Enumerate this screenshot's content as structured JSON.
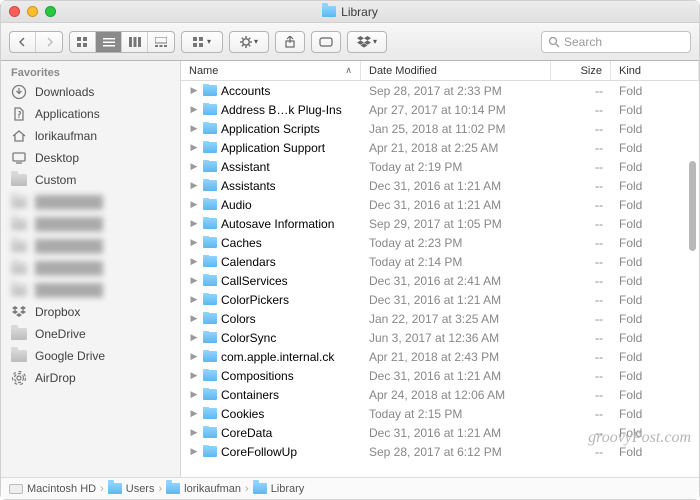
{
  "window": {
    "title": "Library"
  },
  "toolbar": {
    "search_placeholder": "Search"
  },
  "sidebar": {
    "header": "Favorites",
    "items": [
      {
        "label": "Downloads",
        "icon": "downloads"
      },
      {
        "label": "Applications",
        "icon": "applications"
      },
      {
        "label": "lorikaufman",
        "icon": "home"
      },
      {
        "label": "Desktop",
        "icon": "desktop"
      },
      {
        "label": "Custom",
        "icon": "folder"
      }
    ],
    "blurred_count": 5,
    "items2": [
      {
        "label": "Dropbox",
        "icon": "dropbox"
      },
      {
        "label": "OneDrive",
        "icon": "folder"
      },
      {
        "label": "Google Drive",
        "icon": "folder"
      },
      {
        "label": "AirDrop",
        "icon": "airdrop"
      }
    ]
  },
  "columns": {
    "name": "Name",
    "date": "Date Modified",
    "size": "Size",
    "kind": "Kind"
  },
  "sort": {
    "column": "name",
    "direction": "asc"
  },
  "rows": [
    {
      "name": "Accounts",
      "date": "Sep 28, 2017 at 2:33 PM",
      "size": "--",
      "kind": "Folder"
    },
    {
      "name": "Address B…k Plug-Ins",
      "date": "Apr 27, 2017 at 10:14 PM",
      "size": "--",
      "kind": "Folder"
    },
    {
      "name": "Application Scripts",
      "date": "Jan 25, 2018 at 11:02 PM",
      "size": "--",
      "kind": "Folder"
    },
    {
      "name": "Application Support",
      "date": "Apr 21, 2018 at 2:25 AM",
      "size": "--",
      "kind": "Folder"
    },
    {
      "name": "Assistant",
      "date": "Today at 2:19 PM",
      "size": "--",
      "kind": "Folder"
    },
    {
      "name": "Assistants",
      "date": "Dec 31, 2016 at 1:21 AM",
      "size": "--",
      "kind": "Folder"
    },
    {
      "name": "Audio",
      "date": "Dec 31, 2016 at 1:21 AM",
      "size": "--",
      "kind": "Folder"
    },
    {
      "name": "Autosave Information",
      "date": "Sep 29, 2017 at 1:05 PM",
      "size": "--",
      "kind": "Folder"
    },
    {
      "name": "Caches",
      "date": "Today at 2:23 PM",
      "size": "--",
      "kind": "Folder"
    },
    {
      "name": "Calendars",
      "date": "Today at 2:14 PM",
      "size": "--",
      "kind": "Folder"
    },
    {
      "name": "CallServices",
      "date": "Dec 31, 2016 at 2:41 AM",
      "size": "--",
      "kind": "Folder"
    },
    {
      "name": "ColorPickers",
      "date": "Dec 31, 2016 at 1:21 AM",
      "size": "--",
      "kind": "Folder"
    },
    {
      "name": "Colors",
      "date": "Jan 22, 2017 at 3:25 AM",
      "size": "--",
      "kind": "Folder"
    },
    {
      "name": "ColorSync",
      "date": "Jun 3, 2017 at 12:36 AM",
      "size": "--",
      "kind": "Folder"
    },
    {
      "name": "com.apple.internal.ck",
      "date": "Apr 21, 2018 at 2:43 PM",
      "size": "--",
      "kind": "Folder"
    },
    {
      "name": "Compositions",
      "date": "Dec 31, 2016 at 1:21 AM",
      "size": "--",
      "kind": "Folder"
    },
    {
      "name": "Containers",
      "date": "Apr 24, 2018 at 12:06 AM",
      "size": "--",
      "kind": "Folder"
    },
    {
      "name": "Cookies",
      "date": "Today at 2:15 PM",
      "size": "--",
      "kind": "Folder"
    },
    {
      "name": "CoreData",
      "date": "Dec 31, 2016 at 1:21 AM",
      "size": "--",
      "kind": "Folder"
    },
    {
      "name": "CoreFollowUp",
      "date": "Sep 28, 2017 at 6:12 PM",
      "size": "--",
      "kind": "Folder"
    }
  ],
  "pathbar": [
    {
      "label": "Macintosh HD",
      "icon": "drive"
    },
    {
      "label": "Users",
      "icon": "folder"
    },
    {
      "label": "lorikaufman",
      "icon": "folder"
    },
    {
      "label": "Library",
      "icon": "folder"
    }
  ],
  "watermark": "groovyPost.com"
}
